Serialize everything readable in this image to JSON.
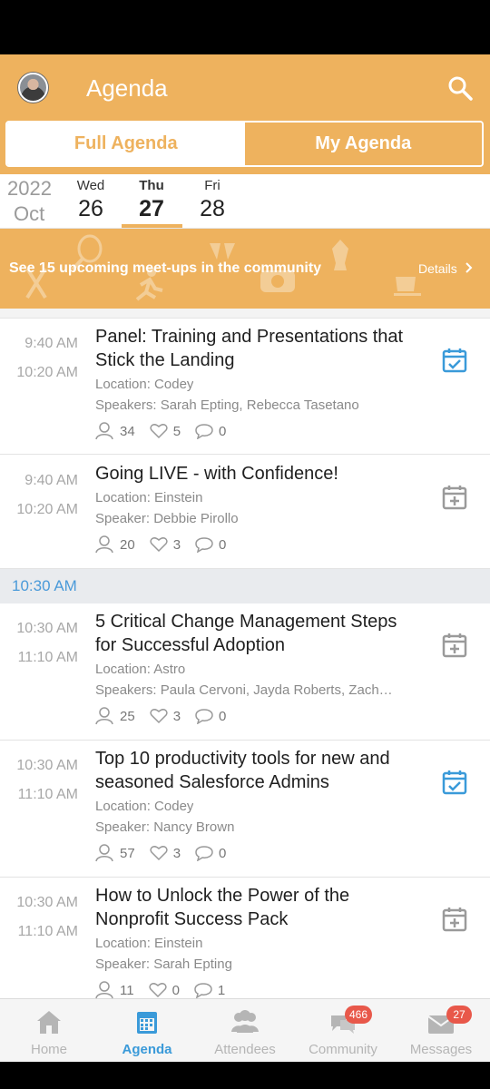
{
  "header": {
    "title": "Agenda"
  },
  "segments": {
    "full": "Full Agenda",
    "mine": "My Agenda"
  },
  "dates": {
    "year": "2022",
    "month": "Oct",
    "days": [
      {
        "name": "Wed",
        "num": "26"
      },
      {
        "name": "Thu",
        "num": "27"
      },
      {
        "name": "Fri",
        "num": "28"
      }
    ]
  },
  "banner": {
    "text": "See 15 upcoming meet-ups in the community",
    "details": "Details"
  },
  "time_header": "10:30 AM",
  "sessions": [
    {
      "start": "9:40 AM",
      "end": "10:20 AM",
      "title": "Panel: Training and Presentations that Stick the Landing",
      "location": "Location: Codey",
      "speakers": "Speakers: Sarah Epting, Rebecca Tasetano",
      "attendees": "34",
      "likes": "5",
      "comments": "0",
      "action_icon": "calendar-check-icon"
    },
    {
      "start": "9:40 AM",
      "end": "10:20 AM",
      "title": "Going LIVE - with Confidence!",
      "location": "Location: Einstein",
      "speakers": "Speaker: Debbie Pirollo",
      "attendees": "20",
      "likes": "3",
      "comments": "0",
      "action_icon": "calendar-add-icon"
    },
    {
      "start": "10:30 AM",
      "end": "11:10 AM",
      "title": "5 Critical Change Management Steps for Successful Adoption",
      "location": "Location: Astro",
      "speakers": "Speakers: Paula Cervoni, Jayda Roberts, Zach…",
      "attendees": "25",
      "likes": "3",
      "comments": "0",
      "action_icon": "calendar-add-icon"
    },
    {
      "start": "10:30 AM",
      "end": "11:10 AM",
      "title": "Top 10 productivity tools for new and seasoned Salesforce Admins",
      "location": "Location: Codey",
      "speakers": "Speaker: Nancy Brown",
      "attendees": "57",
      "likes": "3",
      "comments": "0",
      "action_icon": "calendar-check-icon"
    },
    {
      "start": "10:30 AM",
      "end": "11:10 AM",
      "title": "How to Unlock the Power of the Nonprofit Success Pack",
      "location": "Location: Einstein",
      "speakers": "Speaker: Sarah Epting",
      "attendees": "11",
      "likes": "0",
      "comments": "1",
      "action_icon": "calendar-add-icon"
    }
  ],
  "tabs": [
    {
      "label": "Home",
      "icon": "home-icon"
    },
    {
      "label": "Agenda",
      "icon": "calendar-icon"
    },
    {
      "label": "Attendees",
      "icon": "people-icon"
    },
    {
      "label": "Community",
      "icon": "chat-icon",
      "badge": "466"
    },
    {
      "label": "Messages",
      "icon": "envelope-icon",
      "badge": "27"
    }
  ],
  "colors": {
    "brand": "#EEB25E",
    "accent": "#3A9AD9",
    "badge": "#E8584A"
  }
}
